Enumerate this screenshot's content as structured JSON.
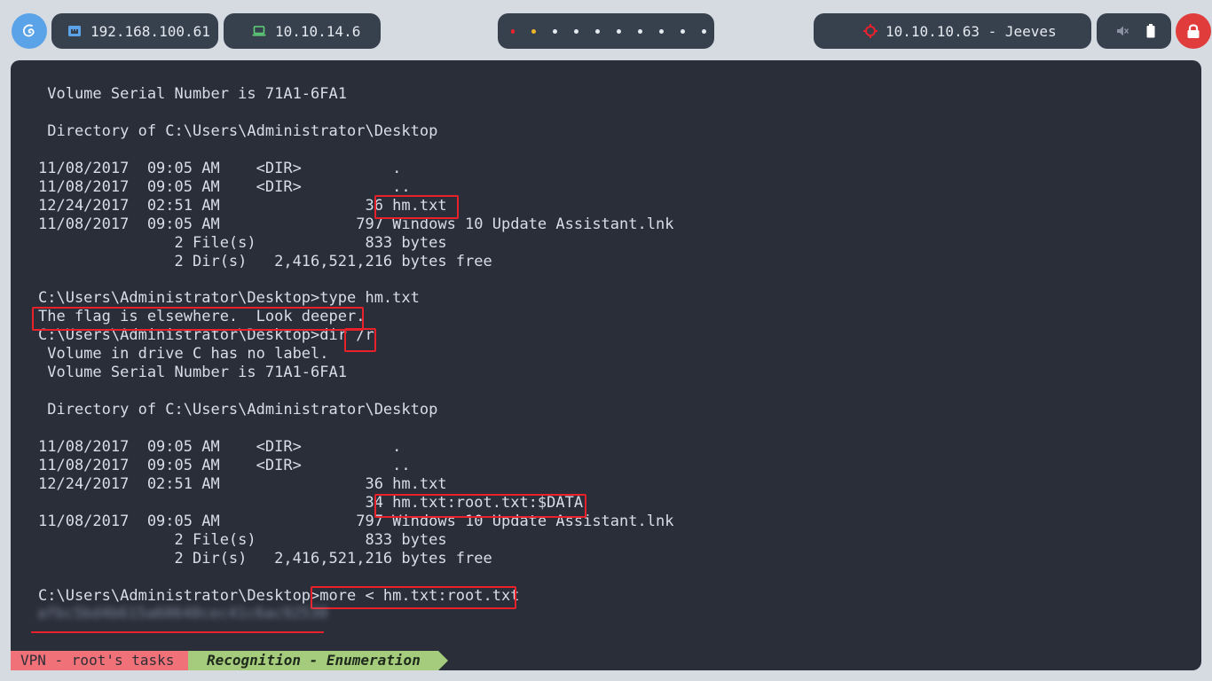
{
  "topbar": {
    "ip_local": "192.168.100.61",
    "ip_vpn": "10.10.14.6",
    "target": "10.10.10.63 - Jeeves",
    "colors": {
      "pill": "#37404d",
      "logo": "#5aa3e8",
      "lock": "#e03c3c",
      "target_icon": "#e8212b"
    },
    "icons": [
      "debian-swirl-icon",
      "network-icon",
      "laptop-icon",
      "crosshair-icon",
      "mute-icon",
      "battery-icon",
      "lock-icon"
    ]
  },
  "terminal": {
    "lines": [
      " Volume Serial Number is 71A1-6FA1",
      "",
      " Directory of C:\\Users\\Administrator\\Desktop",
      "",
      "11/08/2017  09:05 AM    <DIR>          .",
      "11/08/2017  09:05 AM    <DIR>          ..",
      "12/24/2017  02:51 AM                36 hm.txt",
      "11/08/2017  09:05 AM               797 Windows 10 Update Assistant.lnk",
      "               2 File(s)            833 bytes",
      "               2 Dir(s)   2,416,521,216 bytes free",
      "",
      "C:\\Users\\Administrator\\Desktop>type hm.txt",
      "The flag is elsewhere.  Look deeper.",
      "C:\\Users\\Administrator\\Desktop>dir /r",
      " Volume in drive C has no label.",
      " Volume Serial Number is 71A1-6FA1",
      "",
      " Directory of C:\\Users\\Administrator\\Desktop",
      "",
      "11/08/2017  09:05 AM    <DIR>          .",
      "11/08/2017  09:05 AM    <DIR>          ..",
      "12/24/2017  02:51 AM                36 hm.txt",
      "                                    34 hm.txt:root.txt:$DATA",
      "11/08/2017  09:05 AM               797 Windows 10 Update Assistant.lnk",
      "               2 File(s)            833 bytes",
      "               2 Dir(s)   2,416,521,216 bytes free",
      "",
      "C:\\Users\\Administrator\\Desktop>more < hm.txt:root.txt"
    ],
    "redacted_flag": "afbc5bd4b615a60648cec41c6ac92530",
    "highlight_color": "#e8212b"
  },
  "statusbar": {
    "session": "VPN - root's tasks",
    "task": "Recognition - Enumeration",
    "colors": {
      "session": "#f07178",
      "task": "#a4cc7c"
    }
  }
}
